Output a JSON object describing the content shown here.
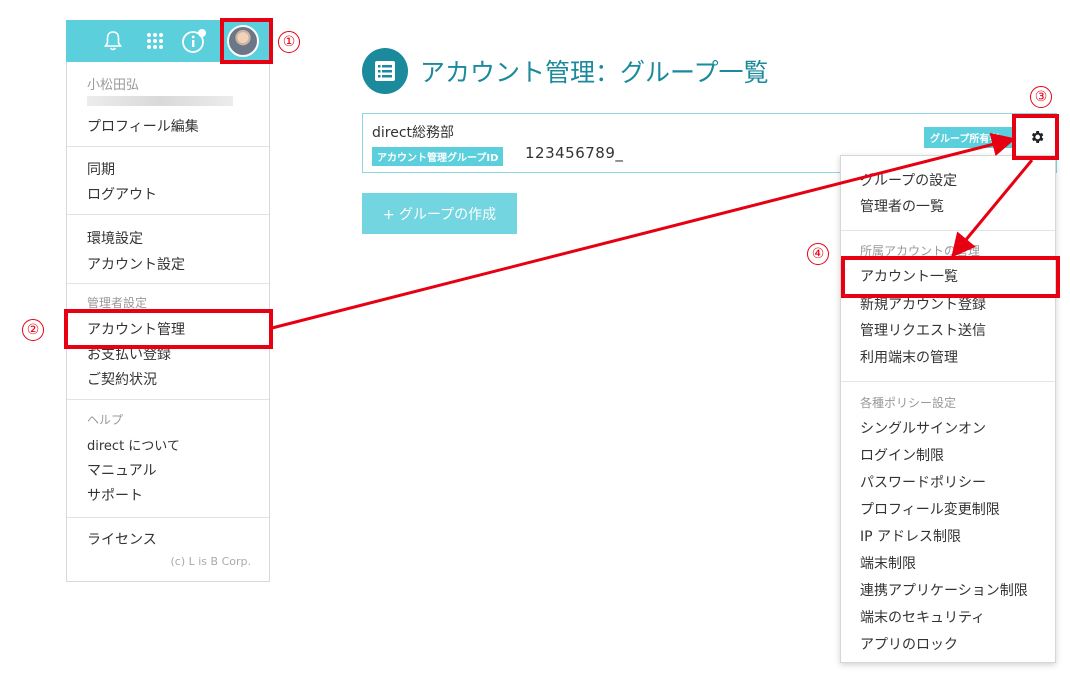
{
  "usermenu": {
    "user_name": "小松田弘",
    "profile_edit": "プロフィール編集",
    "sync": "同期",
    "logout": "ログアウト",
    "env_settings": "環境設定",
    "account_settings": "アカウント設定",
    "admin_section": "管理者設定",
    "account_management": "アカウント管理",
    "payment_registration": "お支払い登録",
    "contract_status": "ご契約状況",
    "help_section": "ヘルプ",
    "about": "direct について",
    "manual": "マニュアル",
    "support": "サポート",
    "license": "ライセンス",
    "copyright": "(c) L is B Corp."
  },
  "topbar": {
    "icons": [
      "bell-icon",
      "apps-grid-icon",
      "info-icon"
    ],
    "accent": "#5bcfdc"
  },
  "main": {
    "title": "アカウント管理：グループ一覧",
    "group": {
      "name": "direct総務部",
      "id_label": "アカウント管理グループID",
      "id_value": "123456789_",
      "owner_badge": "グループ所有者"
    },
    "create_button": "+ グループの作成",
    "title_color": "#1a8a9c"
  },
  "dropdown": {
    "items_top": [
      "グループの設定",
      "管理者の一覧"
    ],
    "section_accounts": "所属アカウントの管理",
    "items_accounts": [
      "アカウント一覧",
      "新規アカウント登録",
      "管理リクエスト送信",
      "利用端末の管理"
    ],
    "section_policy": "各種ポリシー設定",
    "items_policy": [
      "シングルサインオン",
      "ログイン制限",
      "パスワードポリシー",
      "プロフィール変更制限",
      "IP アドレス制限",
      "端末制限",
      "連携アプリケーション制限",
      "端末のセキュリティ",
      "アプリのロック"
    ]
  },
  "annotations": {
    "steps": [
      "①",
      "②",
      "③",
      "④"
    ],
    "color": "#e60012"
  }
}
